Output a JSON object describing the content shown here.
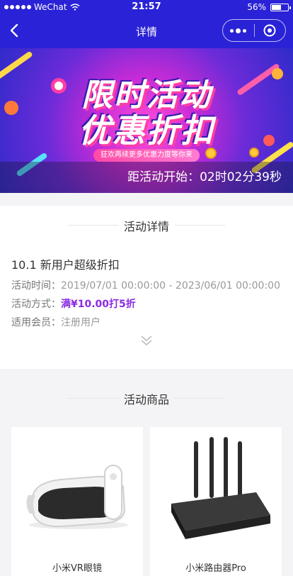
{
  "status_bar": {
    "carrier": "WeChat",
    "time": "21:57",
    "battery": "56%"
  },
  "nav": {
    "title": "详情"
  },
  "banner": {
    "headline_1": "限时活动",
    "headline_2": "优惠折扣",
    "ribbon_text": "狂欢再续更多优惠力度等你来",
    "countdown": "距活动开始：02时02分39秒"
  },
  "detail": {
    "section_title": "活动详情",
    "activity_name": "10.1 新用户超级折扣",
    "rows": [
      {
        "label": "活动时间：",
        "value": "2019/07/01 00:00:00 - 2023/06/01 00:00:00"
      },
      {
        "label": "活动方式：",
        "value": "满¥10.00打5折"
      },
      {
        "label": "适用会员：",
        "value": "注册用户"
      }
    ]
  },
  "products": {
    "section_title": "活动商品",
    "items": [
      {
        "name": "小米VR眼镜"
      },
      {
        "name": "小米路由器Pro"
      }
    ]
  },
  "colors": {
    "nav_bg": "#2a22d6",
    "accent_purple": "#8a2be2"
  }
}
